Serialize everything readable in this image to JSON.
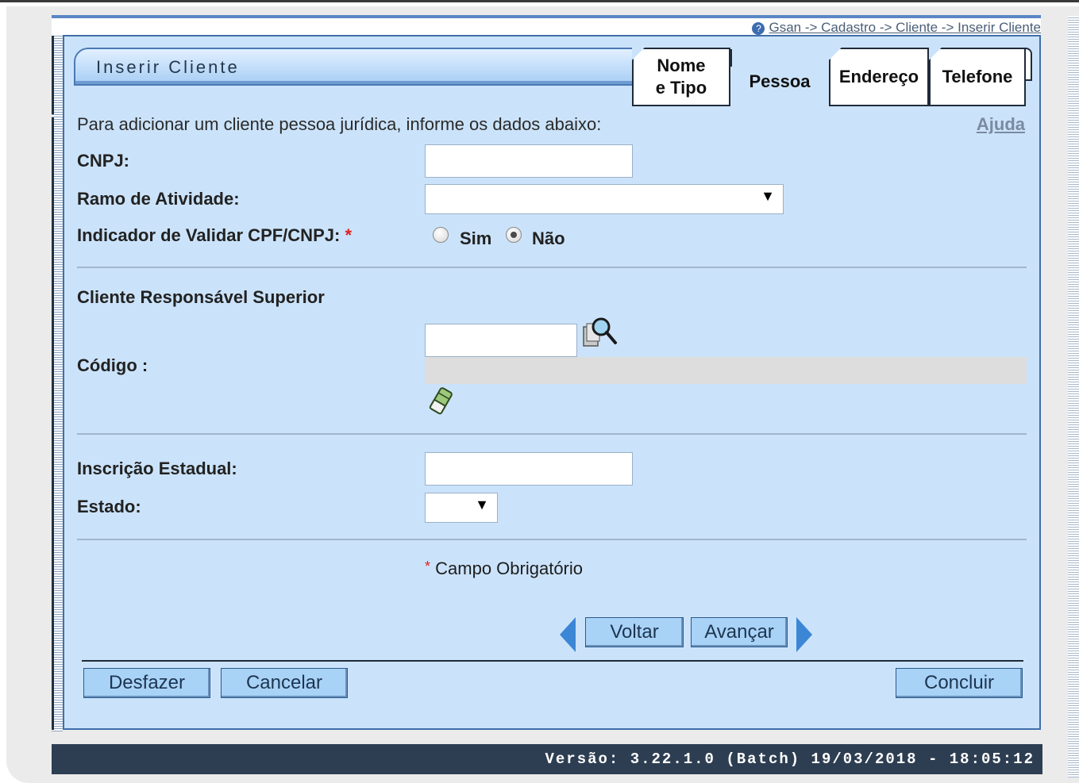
{
  "breadcrumb": "Gsan -> Cadastro -> Cliente -> Inserir Cliente",
  "title": "Inserir Cliente",
  "tabs": [
    {
      "label_line1": "Nome",
      "label_line2": "e Tipo"
    },
    {
      "label": "Pessoa",
      "active": true
    },
    {
      "label": "Endereço"
    },
    {
      "label": "Telefone"
    }
  ],
  "intro": "Para adicionar um cliente pessoa jurídica, informe os dados abaixo:",
  "help_link": "Ajuda",
  "fields": {
    "cnpj": {
      "label": "CNPJ:",
      "value": ""
    },
    "ramo": {
      "label": "Ramo de Atividade:",
      "selected": ""
    },
    "validar": {
      "label": "Indicador de Validar CPF/CNPJ:",
      "required_mark": "*",
      "options": [
        "Sim",
        "Não"
      ],
      "selected": "Não"
    },
    "responsavel_heading": "Cliente Responsável Superior",
    "codigo": {
      "label": "Código :",
      "value": "",
      "description": ""
    },
    "inscricao": {
      "label": "Inscrição Estadual:",
      "value": ""
    },
    "estado": {
      "label": "Estado:",
      "selected": ""
    }
  },
  "required_note": {
    "mark": "*",
    "text": "Campo Obrigatório"
  },
  "nav_buttons": {
    "back": "Voltar",
    "next": "Avançar"
  },
  "actions": {
    "undo": "Desfazer",
    "cancel": "Cancelar",
    "finish": "Concluir"
  },
  "footer": "Versão: 3.22.1.0 (Batch) 19/03/2018 - 18:05:12",
  "colors": {
    "panel_bg": "#cbe3fa",
    "button_bg": "#a9d2f7",
    "footer_bg": "#2e3e52",
    "required": "#e02020"
  }
}
